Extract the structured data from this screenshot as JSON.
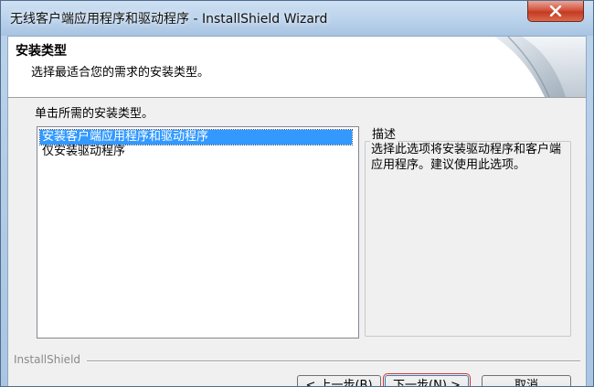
{
  "window": {
    "title": "无线客户端应用程序和驱动程序 - InstallShield Wizard",
    "close_icon": "close-icon"
  },
  "header": {
    "title": "安装类型",
    "subtitle": "选择最适合您的需求的安装类型。"
  },
  "setup": {
    "prompt": "单击所需的安装类型。",
    "options": [
      {
        "label": "安装客户端应用程序和驱动程序",
        "selected": true
      },
      {
        "label": "仅安装驱动程序",
        "selected": false
      }
    ]
  },
  "description": {
    "label": "描述",
    "text": "选择此选项将安装驱动程序和客户端应用程序。建议使用此选项。"
  },
  "footer": {
    "brand": "InstallShield",
    "back_label": "< 上一步(B)",
    "next_label": "下一步(N) >",
    "cancel_label": "取消"
  },
  "colors": {
    "selection": "#3399ff",
    "close_button": "#c43a22",
    "highlight_outline": "#e03030"
  }
}
